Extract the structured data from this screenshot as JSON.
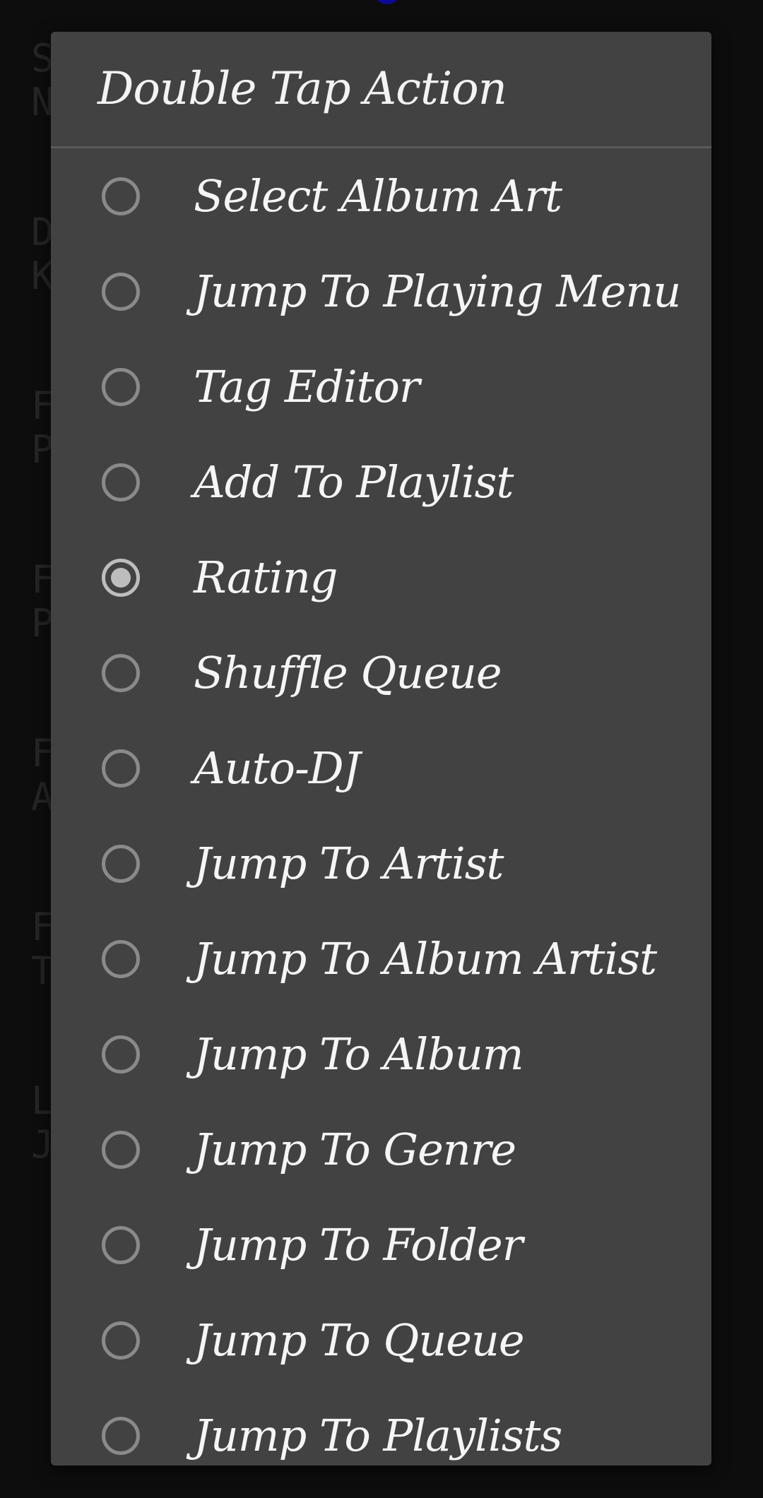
{
  "background_settings": {
    "items": [
      {
        "line1": "S",
        "line2": "N"
      },
      {
        "line1": "D",
        "line2": "K"
      },
      {
        "line1": "F",
        "line2": "P"
      },
      {
        "line1": "F",
        "line2": "P"
      },
      {
        "line1": "F",
        "line2": "A"
      },
      {
        "line1": "F",
        "line2": "T"
      },
      {
        "line1": "L",
        "line2": "J"
      }
    ]
  },
  "dialog": {
    "title": "Double Tap Action",
    "selected_index": 4,
    "options": [
      {
        "label": "Select Album Art"
      },
      {
        "label": "Jump To Playing Menu"
      },
      {
        "label": "Tag Editor"
      },
      {
        "label": "Add To Playlist"
      },
      {
        "label": "Rating"
      },
      {
        "label": "Shuffle Queue"
      },
      {
        "label": "Auto-DJ"
      },
      {
        "label": "Jump To Artist"
      },
      {
        "label": "Jump To Album Artist"
      },
      {
        "label": "Jump To Album"
      },
      {
        "label": "Jump To Genre"
      },
      {
        "label": "Jump To Folder"
      },
      {
        "label": "Jump To Queue"
      },
      {
        "label": "Jump To Playlists"
      }
    ]
  },
  "colors": {
    "dialog_bg": "#424242",
    "screen_bg": "#151515",
    "radio_checked": "#bdbdbd",
    "radio_unchecked": "#8a8a8a",
    "indicator": "#1010e8"
  }
}
